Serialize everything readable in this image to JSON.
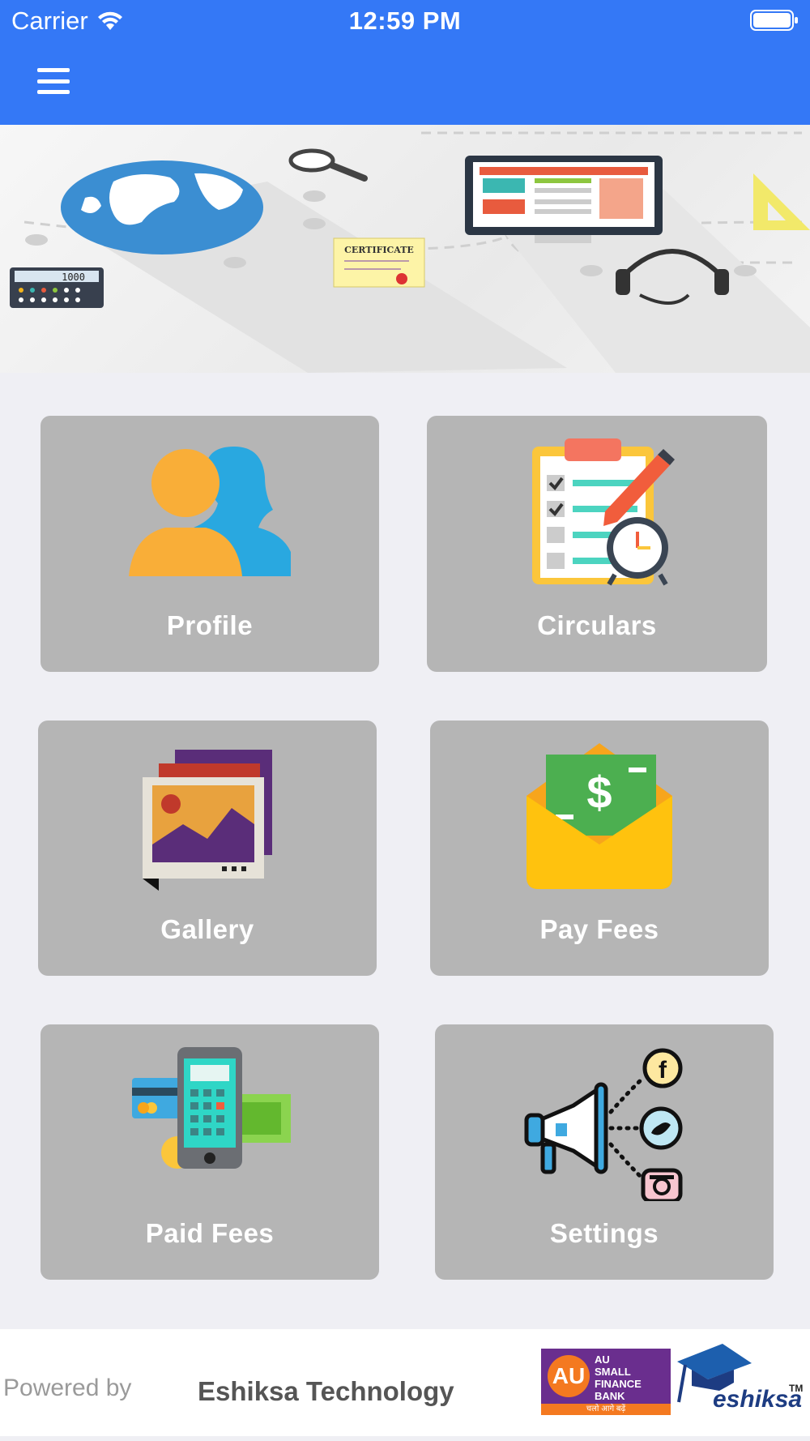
{
  "status_bar": {
    "carrier": "Carrier",
    "time": "12:59 PM"
  },
  "header": {
    "menu_icon": "hamburger-menu-icon"
  },
  "banner": {
    "certificate_text": "CERTIFICATE",
    "calculator_display": "1000"
  },
  "tiles": [
    {
      "label": "Profile",
      "icon": "profile-icon"
    },
    {
      "label": "Circulars",
      "icon": "circulars-icon"
    },
    {
      "label": "Gallery",
      "icon": "gallery-icon"
    },
    {
      "label": "Pay Fees",
      "icon": "pay-fees-icon"
    },
    {
      "label": "Paid Fees",
      "icon": "paid-fees-icon"
    },
    {
      "label": "Settings",
      "icon": "settings-icon"
    }
  ],
  "footer": {
    "powered_by": "Powered by",
    "company": "Eshiksa Technology",
    "au_short": "AU",
    "au_name_line1": "AU",
    "au_name_line2": "SMALL",
    "au_name_line3": "FINANCE",
    "au_name_line4": "BANK",
    "au_tagline": "चलो आगे बढ़ें",
    "eshiksa_brand": "eshiksa",
    "eshiksa_tm": "TM"
  },
  "colors": {
    "header_blue": "#3478f6",
    "tile_gray": "#b5b5b5",
    "background": "#efeff4"
  }
}
